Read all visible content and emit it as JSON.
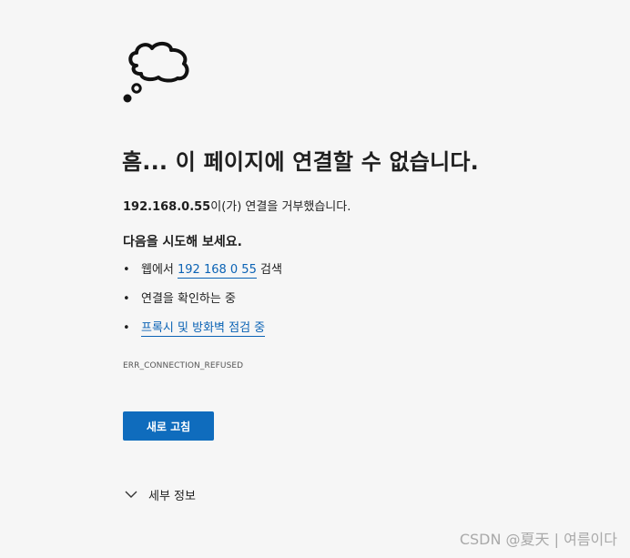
{
  "error": {
    "icon": "thought-bubble-icon",
    "title": "흠... 이 페이지에 연결할 수 없습니다.",
    "host": "192.168.0.55",
    "refused_text": "이(가) 연결을 거부했습니다.",
    "suggest_heading": "다음을 시도해 보세요.",
    "suggestions": [
      {
        "bullet": "•",
        "prefix": "웹에서 ",
        "link": "192 168 0 55",
        "suffix": " 검색"
      },
      {
        "bullet": "•",
        "text": "연결을 확인하는 중"
      },
      {
        "bullet": "•",
        "link": "프록시 및 방화벽 점검 중"
      }
    ],
    "code": "ERR_CONNECTION_REFUSED",
    "reload_label": "새로 고침",
    "details_label": "세부 정보",
    "details_icon": "chevron-down-icon"
  },
  "watermark": "CSDN @夏天 | 여름이다",
  "colors": {
    "background": "#f6f6f6",
    "accent": "#0f6cbd",
    "link": "#0b63b5",
    "text": "#1f1f1f"
  }
}
